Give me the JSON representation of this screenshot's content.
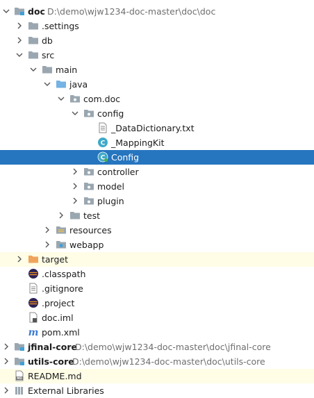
{
  "tree": {
    "root": {
      "name": "doc",
      "path": "D:\\demo\\wjw1234-doc-master\\doc\\doc"
    },
    "settings": ".settings",
    "db": "db",
    "src": "src",
    "main": "main",
    "java": "java",
    "com_doc": "com.doc",
    "config_pkg": "config",
    "data_dictionary": "_DataDictionary.txt",
    "mapping_kit": "_MappingKit",
    "config_class": "Config",
    "controller": "controller",
    "model": "model",
    "plugin": "plugin",
    "test": "test",
    "resources": "resources",
    "webapp": "webapp",
    "target": "target",
    "classpath": ".classpath",
    "gitignore": ".gitignore",
    "project": ".project",
    "doc_iml": "doc.iml",
    "pom_xml": "pom.xml",
    "jfinal_core": {
      "name": "jfinal-core",
      "path": "D:\\demo\\wjw1234-doc-master\\doc\\jfinal-core"
    },
    "utils_core": {
      "name": "utils-core",
      "path": "D:\\demo\\wjw1234-doc-master\\doc\\utils-core"
    },
    "readme": "README.md",
    "external_libraries": "External Libraries"
  },
  "colors": {
    "selection": "#2675bf",
    "excluded_background": "#fffde6",
    "folder": "#9aa7b0",
    "source_folder": "#76b2e3",
    "excluded_folder": "#f0a45b",
    "class_icon": "#3fa9c9"
  }
}
